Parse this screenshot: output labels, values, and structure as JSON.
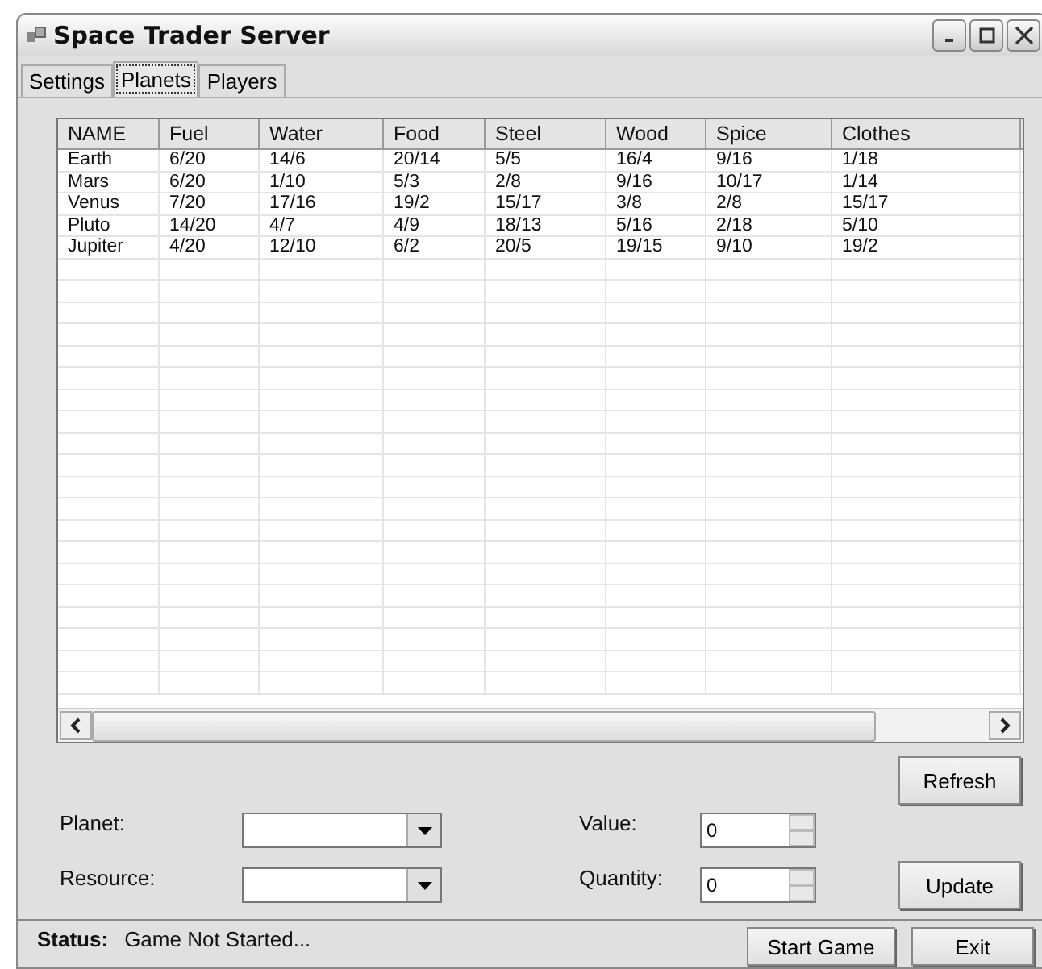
{
  "window": {
    "title": "Space Trader Server"
  },
  "tabs": [
    {
      "label": "Settings",
      "selected": false
    },
    {
      "label": "Planets",
      "selected": true
    },
    {
      "label": "Players",
      "selected": false
    }
  ],
  "table": {
    "columns": [
      "NAME",
      "Fuel",
      "Water",
      "Food",
      "Steel",
      "Wood",
      "Spice",
      "Clothes"
    ],
    "rows": [
      [
        "Earth",
        "6/20",
        "14/6",
        "20/14",
        "5/5",
        "16/4",
        "9/16",
        "1/18"
      ],
      [
        "Mars",
        "6/20",
        "1/10",
        "5/3",
        "2/8",
        "9/16",
        "10/17",
        "1/14"
      ],
      [
        "Venus",
        "7/20",
        "17/16",
        "19/2",
        "15/17",
        "3/8",
        "2/8",
        "15/17"
      ],
      [
        "Pluto",
        "14/20",
        "4/7",
        "4/9",
        "18/13",
        "5/16",
        "2/18",
        "5/10"
      ],
      [
        "Jupiter",
        "4/20",
        "12/10",
        "6/2",
        "20/5",
        "19/15",
        "9/10",
        "19/2"
      ]
    ]
  },
  "refresh_button": "Refresh",
  "planet": {
    "label": "Planet:"
  },
  "resource": {
    "label": "Resource:"
  },
  "value": {
    "label": "Value:",
    "value": "0"
  },
  "quantity": {
    "label": "Quantity:",
    "value": "0"
  },
  "update_button": "Update",
  "status_bar": {
    "label": "Status:",
    "text": "Game Not Started...",
    "buttons": [
      "Start Game",
      "Exit"
    ]
  }
}
